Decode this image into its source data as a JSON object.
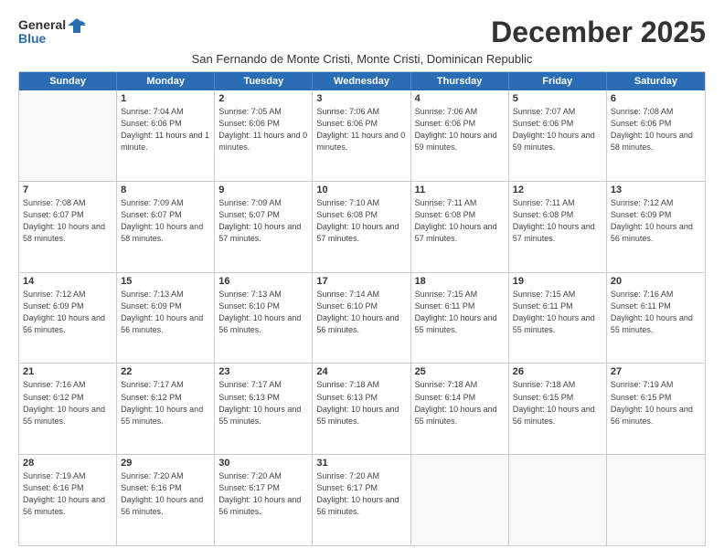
{
  "logo": {
    "general": "General",
    "blue": "Blue",
    "icon": "▶"
  },
  "title": "December 2025",
  "subtitle": "San Fernando de Monte Cristi, Monte Cristi, Dominican Republic",
  "header_days": [
    "Sunday",
    "Monday",
    "Tuesday",
    "Wednesday",
    "Thursday",
    "Friday",
    "Saturday"
  ],
  "weeks": [
    [
      {
        "day": "",
        "sunrise": "",
        "sunset": "",
        "daylight": ""
      },
      {
        "day": "1",
        "sunrise": "Sunrise: 7:04 AM",
        "sunset": "Sunset: 6:06 PM",
        "daylight": "Daylight: 11 hours and 1 minute."
      },
      {
        "day": "2",
        "sunrise": "Sunrise: 7:05 AM",
        "sunset": "Sunset: 6:06 PM",
        "daylight": "Daylight: 11 hours and 0 minutes."
      },
      {
        "day": "3",
        "sunrise": "Sunrise: 7:06 AM",
        "sunset": "Sunset: 6:06 PM",
        "daylight": "Daylight: 11 hours and 0 minutes."
      },
      {
        "day": "4",
        "sunrise": "Sunrise: 7:06 AM",
        "sunset": "Sunset: 6:06 PM",
        "daylight": "Daylight: 10 hours and 59 minutes."
      },
      {
        "day": "5",
        "sunrise": "Sunrise: 7:07 AM",
        "sunset": "Sunset: 6:06 PM",
        "daylight": "Daylight: 10 hours and 59 minutes."
      },
      {
        "day": "6",
        "sunrise": "Sunrise: 7:08 AM",
        "sunset": "Sunset: 6:06 PM",
        "daylight": "Daylight: 10 hours and 58 minutes."
      }
    ],
    [
      {
        "day": "7",
        "sunrise": "Sunrise: 7:08 AM",
        "sunset": "Sunset: 6:07 PM",
        "daylight": "Daylight: 10 hours and 58 minutes."
      },
      {
        "day": "8",
        "sunrise": "Sunrise: 7:09 AM",
        "sunset": "Sunset: 6:07 PM",
        "daylight": "Daylight: 10 hours and 58 minutes."
      },
      {
        "day": "9",
        "sunrise": "Sunrise: 7:09 AM",
        "sunset": "Sunset: 6:07 PM",
        "daylight": "Daylight: 10 hours and 57 minutes."
      },
      {
        "day": "10",
        "sunrise": "Sunrise: 7:10 AM",
        "sunset": "Sunset: 6:08 PM",
        "daylight": "Daylight: 10 hours and 57 minutes."
      },
      {
        "day": "11",
        "sunrise": "Sunrise: 7:11 AM",
        "sunset": "Sunset: 6:08 PM",
        "daylight": "Daylight: 10 hours and 57 minutes."
      },
      {
        "day": "12",
        "sunrise": "Sunrise: 7:11 AM",
        "sunset": "Sunset: 6:08 PM",
        "daylight": "Daylight: 10 hours and 57 minutes."
      },
      {
        "day": "13",
        "sunrise": "Sunrise: 7:12 AM",
        "sunset": "Sunset: 6:09 PM",
        "daylight": "Daylight: 10 hours and 56 minutes."
      }
    ],
    [
      {
        "day": "14",
        "sunrise": "Sunrise: 7:12 AM",
        "sunset": "Sunset: 6:09 PM",
        "daylight": "Daylight: 10 hours and 56 minutes."
      },
      {
        "day": "15",
        "sunrise": "Sunrise: 7:13 AM",
        "sunset": "Sunset: 6:09 PM",
        "daylight": "Daylight: 10 hours and 56 minutes."
      },
      {
        "day": "16",
        "sunrise": "Sunrise: 7:13 AM",
        "sunset": "Sunset: 6:10 PM",
        "daylight": "Daylight: 10 hours and 56 minutes."
      },
      {
        "day": "17",
        "sunrise": "Sunrise: 7:14 AM",
        "sunset": "Sunset: 6:10 PM",
        "daylight": "Daylight: 10 hours and 56 minutes."
      },
      {
        "day": "18",
        "sunrise": "Sunrise: 7:15 AM",
        "sunset": "Sunset: 6:11 PM",
        "daylight": "Daylight: 10 hours and 55 minutes."
      },
      {
        "day": "19",
        "sunrise": "Sunrise: 7:15 AM",
        "sunset": "Sunset: 6:11 PM",
        "daylight": "Daylight: 10 hours and 55 minutes."
      },
      {
        "day": "20",
        "sunrise": "Sunrise: 7:16 AM",
        "sunset": "Sunset: 6:11 PM",
        "daylight": "Daylight: 10 hours and 55 minutes."
      }
    ],
    [
      {
        "day": "21",
        "sunrise": "Sunrise: 7:16 AM",
        "sunset": "Sunset: 6:12 PM",
        "daylight": "Daylight: 10 hours and 55 minutes."
      },
      {
        "day": "22",
        "sunrise": "Sunrise: 7:17 AM",
        "sunset": "Sunset: 6:12 PM",
        "daylight": "Daylight: 10 hours and 55 minutes."
      },
      {
        "day": "23",
        "sunrise": "Sunrise: 7:17 AM",
        "sunset": "Sunset: 6:13 PM",
        "daylight": "Daylight: 10 hours and 55 minutes."
      },
      {
        "day": "24",
        "sunrise": "Sunrise: 7:18 AM",
        "sunset": "Sunset: 6:13 PM",
        "daylight": "Daylight: 10 hours and 55 minutes."
      },
      {
        "day": "25",
        "sunrise": "Sunrise: 7:18 AM",
        "sunset": "Sunset: 6:14 PM",
        "daylight": "Daylight: 10 hours and 55 minutes."
      },
      {
        "day": "26",
        "sunrise": "Sunrise: 7:18 AM",
        "sunset": "Sunset: 6:15 PM",
        "daylight": "Daylight: 10 hours and 56 minutes."
      },
      {
        "day": "27",
        "sunrise": "Sunrise: 7:19 AM",
        "sunset": "Sunset: 6:15 PM",
        "daylight": "Daylight: 10 hours and 56 minutes."
      }
    ],
    [
      {
        "day": "28",
        "sunrise": "Sunrise: 7:19 AM",
        "sunset": "Sunset: 6:16 PM",
        "daylight": "Daylight: 10 hours and 56 minutes."
      },
      {
        "day": "29",
        "sunrise": "Sunrise: 7:20 AM",
        "sunset": "Sunset: 6:16 PM",
        "daylight": "Daylight: 10 hours and 56 minutes."
      },
      {
        "day": "30",
        "sunrise": "Sunrise: 7:20 AM",
        "sunset": "Sunset: 6:17 PM",
        "daylight": "Daylight: 10 hours and 56 minutes."
      },
      {
        "day": "31",
        "sunrise": "Sunrise: 7:20 AM",
        "sunset": "Sunset: 6:17 PM",
        "daylight": "Daylight: 10 hours and 56 minutes."
      },
      {
        "day": "",
        "sunrise": "",
        "sunset": "",
        "daylight": ""
      },
      {
        "day": "",
        "sunrise": "",
        "sunset": "",
        "daylight": ""
      },
      {
        "day": "",
        "sunrise": "",
        "sunset": "",
        "daylight": ""
      }
    ]
  ]
}
